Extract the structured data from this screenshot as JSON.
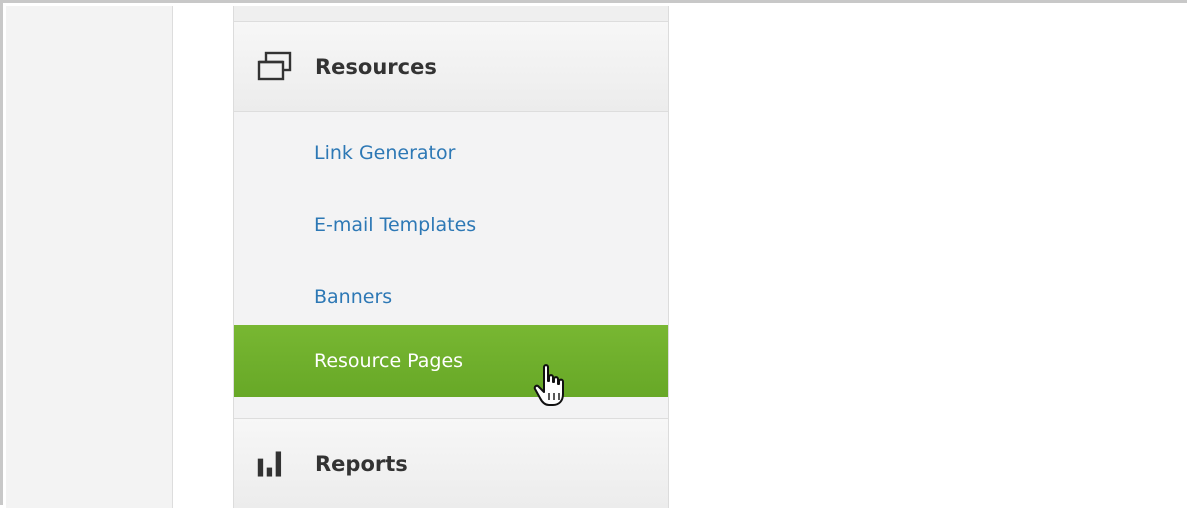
{
  "sections": [
    {
      "title": "Resources",
      "icon": "window-stack-icon",
      "items": [
        {
          "label": "Link Generator",
          "active": false
        },
        {
          "label": "E-mail Templates",
          "active": false
        },
        {
          "label": "Banners",
          "active": false
        },
        {
          "label": "Resource Pages",
          "active": true
        }
      ]
    },
    {
      "title": "Reports",
      "icon": "bar-chart-icon"
    }
  ],
  "colors": {
    "active_background": "#72b12e",
    "link_text": "#2d78b5",
    "header_text": "#333333"
  },
  "cursor": {
    "icon": "hand-pointer-icon"
  }
}
